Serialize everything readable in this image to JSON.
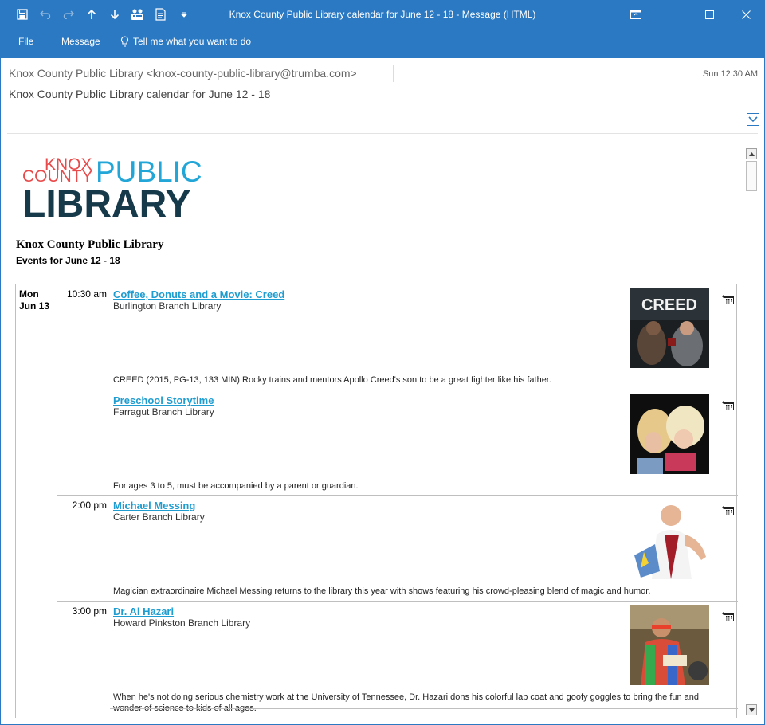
{
  "window": {
    "title": "Knox County Public Library calendar for June 12 - 18 - Message (HTML)"
  },
  "ribbon": {
    "tabs": [
      "File",
      "Message"
    ],
    "tell_me": "Tell me what you want to do"
  },
  "message": {
    "from": "Knox County Public Library <knox-county-public-library@trumba.com>",
    "date": "Sun 12:30 AM",
    "subject": "Knox County Public Library calendar for June 12 - 18"
  },
  "logo": {
    "knox": "KNOX",
    "county": "COUNTY",
    "public": "PUBLIC",
    "library": "LIBRARY"
  },
  "calendar": {
    "title": "Knox County Public Library",
    "subtitle": "Events for June 12 - 18",
    "day": {
      "weekday": "Mon",
      "date": "Jun 13"
    },
    "events": [
      {
        "time": "10:30 am",
        "name": "Coffee, Donuts and a Movie: Creed",
        "location": "Burlington Branch Library",
        "description": "CREED (2015, PG-13, 133 MIN) Rocky trains and mentors Apollo Creed's son to be a great fighter like his father.",
        "image_text": "CREED"
      },
      {
        "time": "",
        "name": "Preschool Storytime",
        "location": "Farragut Branch Library",
        "description": "For ages 3 to 5, must be accompanied by a parent or guardian."
      },
      {
        "time": "2:00 pm",
        "name": "Michael Messing",
        "location": "Carter Branch Library",
        "description": "Magician extraordinaire Michael Messing returns to the library this year with shows featuring his crowd-pleasing blend of magic and humor."
      },
      {
        "time": "3:00 pm",
        "name": "Dr. Al Hazari",
        "location": "Howard Pinkston Branch Library",
        "description": "When he's not doing serious chemistry work at the University of Tennessee, Dr. Hazari dons his colorful lab coat and goofy goggles to bring the fun and wonder of science to kids of all ages."
      }
    ]
  },
  "colors": {
    "accent": "#2b79c2",
    "link": "#1f9dd0",
    "logo_red": "#e84b4b",
    "logo_blue": "#22a6d8",
    "logo_navy": "#173a4b"
  }
}
